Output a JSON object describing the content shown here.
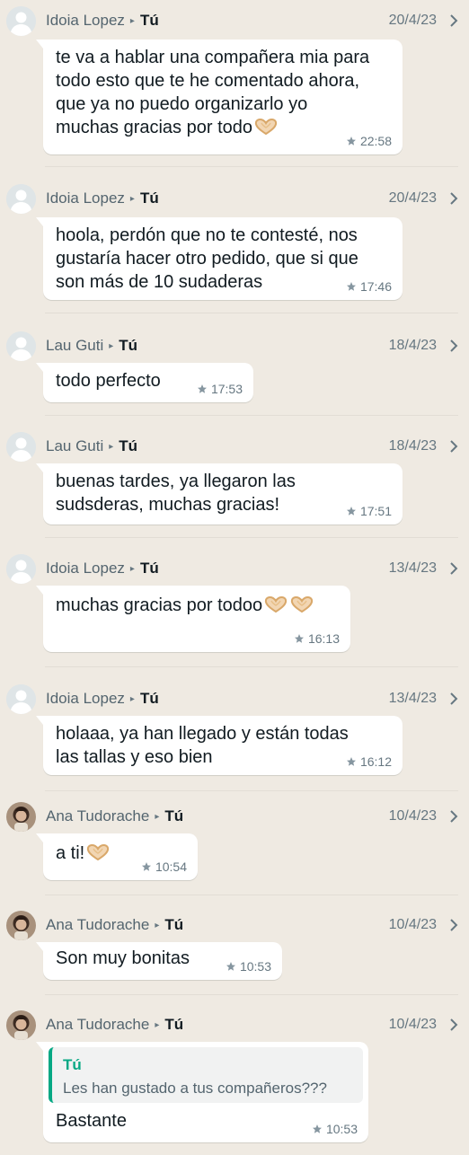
{
  "messages": [
    {
      "sender": "Idoia Lopez",
      "recipient": "Tú",
      "date": "20/4/23",
      "avatar": "default-avatar-icon",
      "lines": [
        "te va a hablar una compañera mia para",
        "todo esto que te he comentado ahora,",
        "que ya no puedo organizarlo yo",
        "muchas gracias por todo"
      ],
      "emoji_count": 1,
      "time": "22:58",
      "starred": true
    },
    {
      "sender": "Idoia Lopez",
      "recipient": "Tú",
      "date": "20/4/23",
      "avatar": "default-avatar-icon",
      "lines": [
        "hoola, perdón que no te contesté, nos",
        "gustaría hacer otro pedido, que si que",
        "son más de 10 sudaderas"
      ],
      "emoji_count": 0,
      "time": "17:46",
      "starred": true
    },
    {
      "sender": "Lau Guti",
      "recipient": "Tú",
      "date": "18/4/23",
      "avatar": "default-avatar-icon",
      "lines": [
        "todo perfecto"
      ],
      "emoji_count": 0,
      "time": "17:53",
      "starred": true
    },
    {
      "sender": "Lau Guti",
      "recipient": "Tú",
      "date": "18/4/23",
      "avatar": "default-avatar-icon",
      "lines": [
        "buenas tardes, ya llegaron las",
        "sudsderas, muchas gracias!"
      ],
      "emoji_count": 0,
      "time": "17:51",
      "starred": true
    },
    {
      "sender": "Idoia Lopez",
      "recipient": "Tú",
      "date": "13/4/23",
      "avatar": "default-avatar-icon",
      "lines": [
        "muchas gracias por todoo"
      ],
      "emoji_count": 2,
      "time": "16:13",
      "starred": true
    },
    {
      "sender": "Idoia Lopez",
      "recipient": "Tú",
      "date": "13/4/23",
      "avatar": "default-avatar-icon",
      "lines": [
        "holaaa, ya han llegado y están todas",
        "las tallas y eso bien"
      ],
      "emoji_count": 0,
      "time": "16:12",
      "starred": true
    },
    {
      "sender": "Ana Tudorache",
      "recipient": "Tú",
      "date": "10/4/23",
      "avatar": "photo-avatar-icon",
      "lines": [
        "a ti!"
      ],
      "emoji_count": 1,
      "time": "10:54",
      "starred": true
    },
    {
      "sender": "Ana Tudorache",
      "recipient": "Tú",
      "date": "10/4/23",
      "avatar": "photo-avatar-icon",
      "lines": [
        "Son muy bonitas"
      ],
      "emoji_count": 0,
      "time": "10:53",
      "starred": true
    },
    {
      "sender": "Ana Tudorache",
      "recipient": "Tú",
      "date": "10/4/23",
      "avatar": "photo-avatar-icon",
      "quote": {
        "author": "Tú",
        "text": "Les han gustado a tus compañeros???"
      },
      "lines": [
        "Bastante"
      ],
      "emoji_count": 0,
      "time": "10:53",
      "starred": true
    }
  ],
  "icons": {
    "star": "star-icon",
    "chevron": "chevron-right-icon",
    "emoji": "heart-hands-emoji"
  },
  "colors": {
    "background": "#efeae2",
    "bubble": "#ffffff",
    "accent": "#06a884",
    "secondary_text": "#667781"
  }
}
